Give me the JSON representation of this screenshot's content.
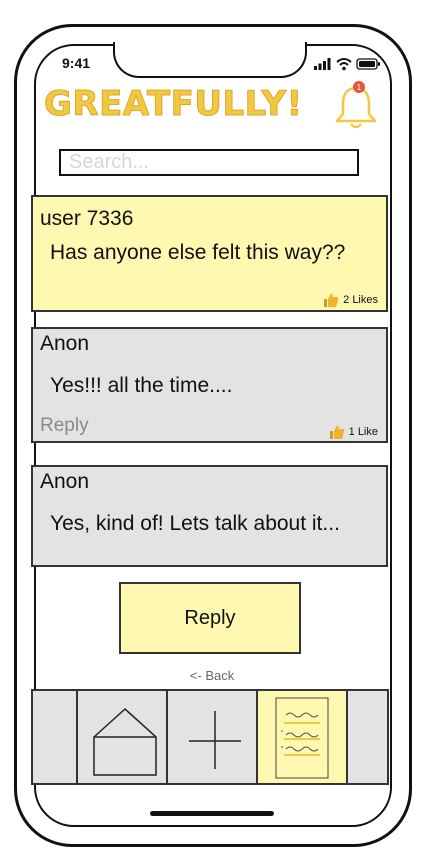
{
  "status_bar": {
    "time": "9:41"
  },
  "app": {
    "title": "GREATFULLY!",
    "notification_count": "1"
  },
  "search": {
    "placeholder": "Search..."
  },
  "posts": [
    {
      "author": "user 7336",
      "text": "Has anyone else felt this way??",
      "likes": "2 Likes"
    },
    {
      "author": "Anon",
      "text": "Yes!!! all the time....",
      "likes": "1 Like",
      "reply_label": "Reply"
    },
    {
      "author": "Anon",
      "text": "Yes, kind of! Lets talk about it..."
    }
  ],
  "actions": {
    "reply_label": "Reply",
    "back_label": "<- Back"
  },
  "nav": [
    {
      "name": "home",
      "icon": "home-icon"
    },
    {
      "name": "add",
      "icon": "plus-icon"
    },
    {
      "name": "notes",
      "icon": "notes-icon",
      "active": true
    }
  ],
  "colors": {
    "brand": "#f3c73f",
    "highlight": "#fff8b0",
    "card_gray": "#e3e3e3",
    "badge": "#e8553a"
  }
}
